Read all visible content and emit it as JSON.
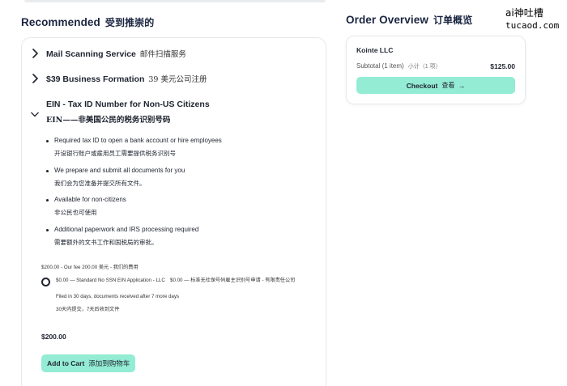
{
  "recommended": {
    "title": "Recommended",
    "title_cn": "受到推崇的",
    "accordion": [
      {
        "label": "Mail Scanning Service",
        "label_cn": "邮件扫描服务",
        "expanded": false
      },
      {
        "label": "$39 Business Formation",
        "label_cn": "39 美元公司注册",
        "expanded": false
      },
      {
        "label": "EIN - Tax ID Number for Non-US Citizens",
        "label_cn": "EIN——非美国公民的税务识别号码",
        "expanded": true
      }
    ],
    "bullets": [
      {
        "en": "Required tax ID to open a bank account or hire employees",
        "zh": "开设银行账户或雇用员工需要提供税务识别号"
      },
      {
        "en": "We prepare and submit all documents for you",
        "zh": "我们会为您准备并提交所有文件。"
      },
      {
        "en": "Available for non-citizens",
        "zh": "非公民也可使用"
      },
      {
        "en": "Additional paperwork and IRS processing required",
        "zh": "需要额外的文书工作和国税局的审批。"
      }
    ],
    "fee_line": "$200.00 - Our fee   200.00 美元 - 我们的费用",
    "option": {
      "label_en": "$0.00 — Standard No SSN EIN Application - LLC",
      "label_cn": "$0.00 — 标准无社保号码雇主识别号申请 - 有限责任公司",
      "filed": "Filed in 30 days, documents received after 7 more days",
      "filed_cn": "30天内提交，7天后收到文件"
    },
    "price": "$200.00",
    "add_to_cart": "Add to Cart",
    "add_to_cart_cn": "添加到购物车"
  },
  "order": {
    "title": "Order Overview",
    "title_cn": "订单概览",
    "company": "Kointe LLC",
    "subtotal": "Subtotal (1 item)",
    "subtotal_cn": "小计（1 项）",
    "amount": "$125.00",
    "checkout": "Checkout",
    "checkout_cn": "查看",
    "checkout_arrow": "→"
  },
  "watermark": {
    "line1": "ai神吐槽",
    "line2": "tucaod.com"
  },
  "colors": {
    "accent": "#93ecd3",
    "title": "#1b2540",
    "border": "#e6e8ec"
  }
}
